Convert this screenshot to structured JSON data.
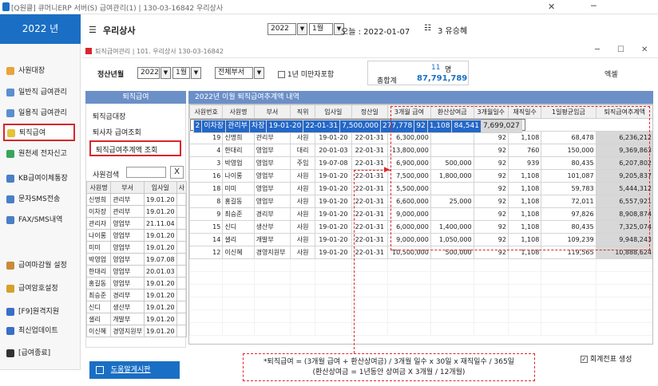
{
  "window": {
    "title": "[Q원클] 큐머니ERP 서버(S)   급여관리(1) | 130-03-16842   우리상사",
    "minimize": "─",
    "close": "✕"
  },
  "app": {
    "year": "2022 년",
    "company": "우리상사",
    "year_select": "2022",
    "month_select": "1월",
    "today": "오늘 : 2022-01-07",
    "user": "3 유승혜"
  },
  "sidebar": {
    "items": [
      {
        "label": "사원대장",
        "color": "#e8a33a"
      },
      {
        "label": "일반직 급여관리",
        "color": "#5b8fd0"
      },
      {
        "label": "일용직 급여관리",
        "color": "#5b8fd0"
      },
      {
        "label": "퇴직급여",
        "color": "#e5c23a"
      },
      {
        "label": "원천세 전자신고",
        "color": "#3aa55a"
      },
      {
        "label": "KB급여이체통장",
        "color": "#4a7fc7"
      },
      {
        "label": "문자SMS전송",
        "color": "#4a7fc7"
      },
      {
        "label": "FAX/SMS내역",
        "color": "#4a7fc7"
      },
      {
        "label": "급여마감월 설정",
        "color": "#c98b3a"
      },
      {
        "label": "급여암호설정",
        "color": "#d4a12a"
      },
      {
        "label": "[F9]원격지원",
        "color": "#3a6ec7"
      },
      {
        "label": "최신업데이트",
        "color": "#3a6ec7"
      },
      {
        "label": "[급여종료]",
        "color": "#333333"
      }
    ]
  },
  "inner_window": {
    "title": "퇴직급여관리 | 101. 우리상사 130-03-16842",
    "minimize": "─",
    "maximize": "☐",
    "close": "✕"
  },
  "filters": {
    "period_label": "정산년월",
    "year": "2022",
    "month": "1월",
    "dept": "전체부서",
    "under_one_year_label": "1년 미만자포함",
    "count": "11",
    "count_unit": "명",
    "total_label": "총합계",
    "total": "87,791,789",
    "excel": "엑셀"
  },
  "side_tabs": {
    "header": "퇴직급여",
    "items": [
      "퇴직금대장",
      "퇴사자 급여조회",
      "퇴직급여추계액 조회"
    ],
    "search_label": "사원검색",
    "search_clear": "X"
  },
  "emp_table": {
    "columns": [
      "사원명",
      "부서",
      "입사일",
      "사"
    ],
    "rows": [
      [
        "신명희",
        "관리부",
        "19.01.20"
      ],
      [
        "이차장",
        "관리부",
        "19.01.20"
      ],
      [
        "관리자",
        "영업부",
        "21.11.04"
      ],
      [
        "나이롱",
        "영업부",
        "19.01.20"
      ],
      [
        "미미",
        "영업부",
        "19.01.20"
      ],
      [
        "박영업",
        "영업부",
        "19.07.08"
      ],
      [
        "한대리",
        "영업부",
        "20.01.03"
      ],
      [
        "홍길동",
        "영업부",
        "19.01.20"
      ],
      [
        "최승준",
        "경리부",
        "19.01.20"
      ],
      [
        "신디",
        "생산부",
        "19.01.20"
      ],
      [
        "샐리",
        "개발부",
        "19.01.20"
      ],
      [
        "이신혜",
        "경영지원부",
        "19.01.20"
      ]
    ]
  },
  "grid": {
    "header": "2022년 이월 퇴직급여추계액 내역",
    "columns": [
      "사원번호",
      "사원명",
      "부서",
      "직위",
      "입사일",
      "정산일",
      "3개월 급여",
      "환산상여금",
      "3개월일수",
      "재직일수",
      "1일평균임금",
      "퇴직급여추계액"
    ],
    "rows": [
      [
        "2",
        "이차장",
        "관리부",
        "차장",
        "19-01-20",
        "22-01-31",
        "7,500,000",
        "277,778",
        "92",
        "1,108",
        "84,541",
        "7,699,027"
      ],
      [
        "19",
        "신명희",
        "관리부",
        "사원",
        "19-01-20",
        "22-01-31",
        "6,300,000",
        "",
        "92",
        "1,108",
        "68,478",
        "6,236,212"
      ],
      [
        "4",
        "한대리",
        "영업부",
        "대리",
        "20-01-03",
        "22-01-31",
        "13,800,000",
        "",
        "92",
        "760",
        "150,000",
        "9,369,863"
      ],
      [
        "3",
        "박영업",
        "영업부",
        "주임",
        "19-07-08",
        "22-01-31",
        "6,900,000",
        "500,000",
        "92",
        "939",
        "80,435",
        "6,207,802"
      ],
      [
        "16",
        "나이롱",
        "영업부",
        "사원",
        "19-01-20",
        "22-01-31",
        "7,500,000",
        "1,800,000",
        "92",
        "1,108",
        "101,087",
        "9,205,837"
      ],
      [
        "18",
        "미미",
        "영업부",
        "사원",
        "19-01-20",
        "22-01-31",
        "5,500,000",
        "",
        "92",
        "1,108",
        "59,783",
        "5,444,312"
      ],
      [
        "8",
        "홍길동",
        "영업부",
        "사원",
        "19-01-20",
        "22-01-31",
        "6,600,000",
        "25,000",
        "92",
        "1,108",
        "72,011",
        "6,557,921"
      ],
      [
        "9",
        "최승준",
        "경리부",
        "사원",
        "19-01-20",
        "22-01-31",
        "9,000,000",
        "",
        "92",
        "1,108",
        "97,826",
        "8,908,874"
      ],
      [
        "15",
        "신디",
        "생산부",
        "사원",
        "19-01-20",
        "22-01-31",
        "6,000,000",
        "1,400,000",
        "92",
        "1,108",
        "80,435",
        "7,325,074"
      ],
      [
        "14",
        "샐리",
        "개발부",
        "사원",
        "19-01-20",
        "22-01-31",
        "9,000,000",
        "1,050,000",
        "92",
        "1,108",
        "109,239",
        "9,948,243"
      ],
      [
        "12",
        "이신혜",
        "경영지원부",
        "사원",
        "19-01-20",
        "22-01-31",
        "10,500,000",
        "500,000",
        "92",
        "1,108",
        "119,565",
        "10,888,624"
      ]
    ]
  },
  "formula": {
    "line1": "*퇴직급여  = (3개월 급여  + 환산상여금) / 3개월 일수  x 30일  x 재직일수 / 365일",
    "line2": "(환산상여금 = 1년동안 상여금 X 3개월 / 12개월)"
  },
  "voucher_label": "회계전표 생성",
  "help_button": "도움말게시판",
  "colors": {
    "accent": "#1a6fc4",
    "highlight": "#d9262b",
    "grid_header": "#6b8fc7"
  }
}
